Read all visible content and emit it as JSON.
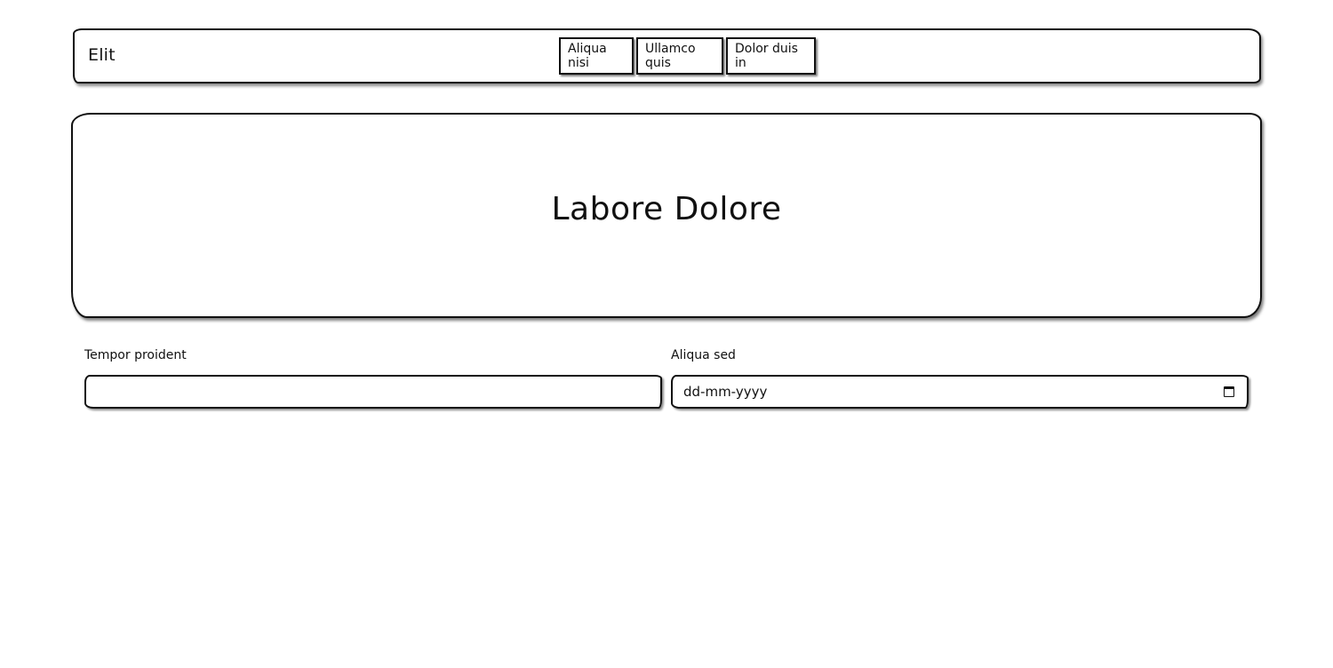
{
  "navbar": {
    "brand": "Elit",
    "links": [
      "Aliqua nisi",
      "Ullamco quis",
      "Dolor duis in"
    ]
  },
  "hero": {
    "title": "Labore Dolore"
  },
  "form": {
    "field1": {
      "label": "Tempor proident",
      "value": ""
    },
    "field2": {
      "label": "Aliqua sed",
      "placeholder": "dd-mm-yyyy"
    }
  }
}
